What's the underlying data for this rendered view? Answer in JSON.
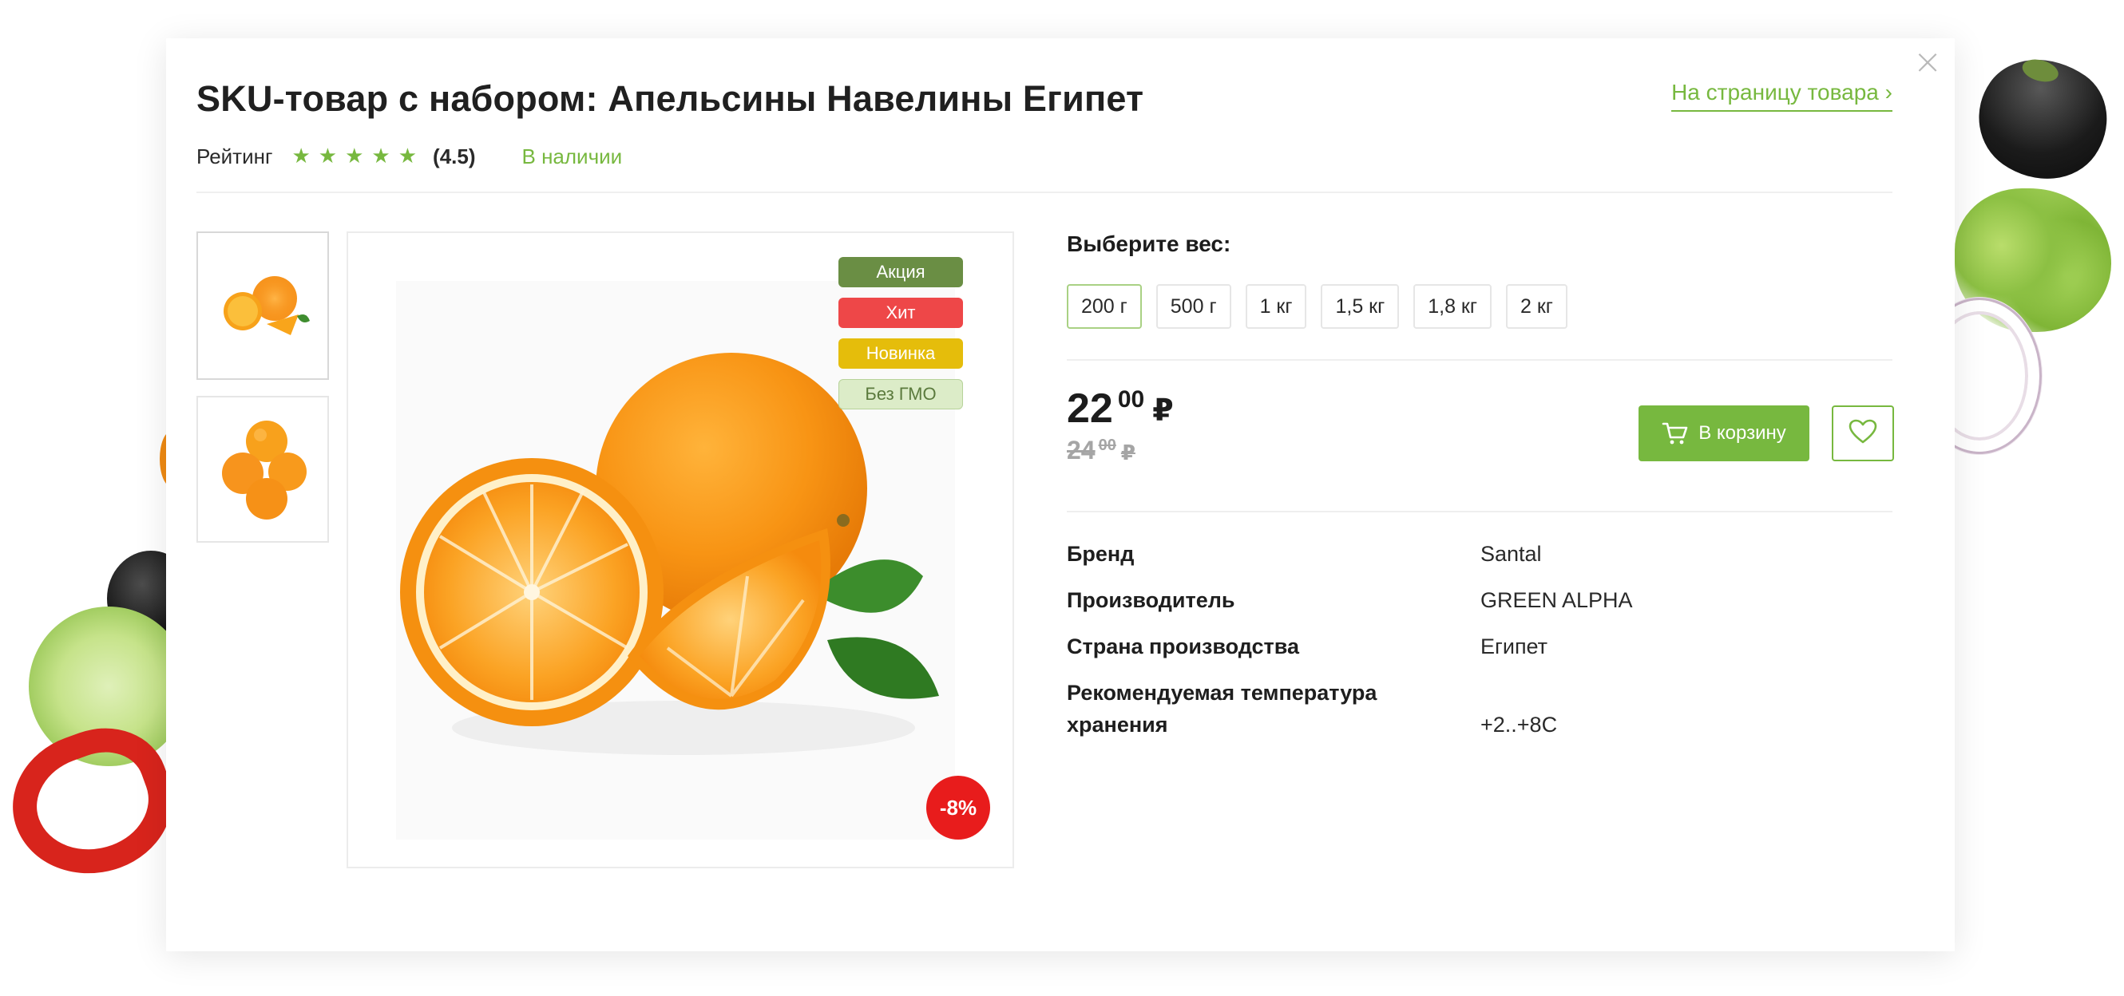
{
  "modal": {
    "title": "SKU-товар с набором: Апельсины Навелины Египет",
    "product_link": "На страницу товара ›",
    "close_glyph": "×"
  },
  "rating": {
    "label": "Рейтинг",
    "stars": 5,
    "value_text": "(4.5)",
    "color": "#77b83f"
  },
  "availability": "В наличии",
  "gallery": {
    "thumbnails": [
      "orange-slices",
      "whole-oranges"
    ],
    "labels": [
      "Акция",
      "Хит",
      "Новинка",
      "Без ГМО"
    ],
    "discount": "-8%"
  },
  "weight": {
    "title": "Выберите вес:",
    "options": [
      "200 г",
      "500 г",
      "1 кг",
      "1,5 кг",
      "1,8 кг",
      "2 кг"
    ],
    "selected": "200 г"
  },
  "price": {
    "current_int": "22",
    "current_dec": "00",
    "old_int": "24",
    "old_dec": "00",
    "currency": "₽"
  },
  "actions": {
    "cart_label": "В корзину",
    "cart_icon": "cart-icon",
    "favorite_icon": "heart-icon"
  },
  "properties": [
    {
      "name": "Бренд",
      "value": "Santal"
    },
    {
      "name": "Производитель",
      "value": "GREEN ALPHA"
    },
    {
      "name": "Страна производства",
      "value": "Египет"
    },
    {
      "name": "Рекомендуемая температура хранения",
      "value": "+2..+8С"
    }
  ],
  "colors": {
    "accent": "#77b83f",
    "label_sale": "#6a8e44",
    "label_hit": "#ee4748",
    "label_new": "#e5bd0b",
    "label_gmo": "#dcecc8",
    "discount": "#e81c1c"
  }
}
